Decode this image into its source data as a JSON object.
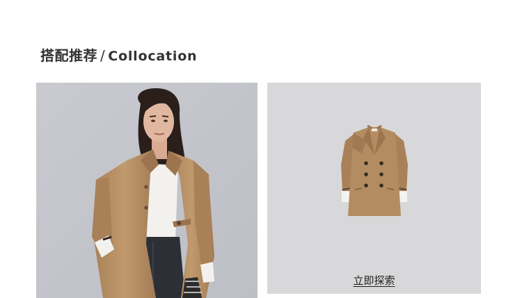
{
  "section": {
    "title_cn": "搭配推荐",
    "separator": "/",
    "title_en": "Collocation"
  },
  "product": {
    "explore_label": "立即探索"
  },
  "colors": {
    "model_bg": "#c5c6cb",
    "product_bg": "#d8d8da",
    "coat": "#b48c61",
    "text": "#333333"
  }
}
